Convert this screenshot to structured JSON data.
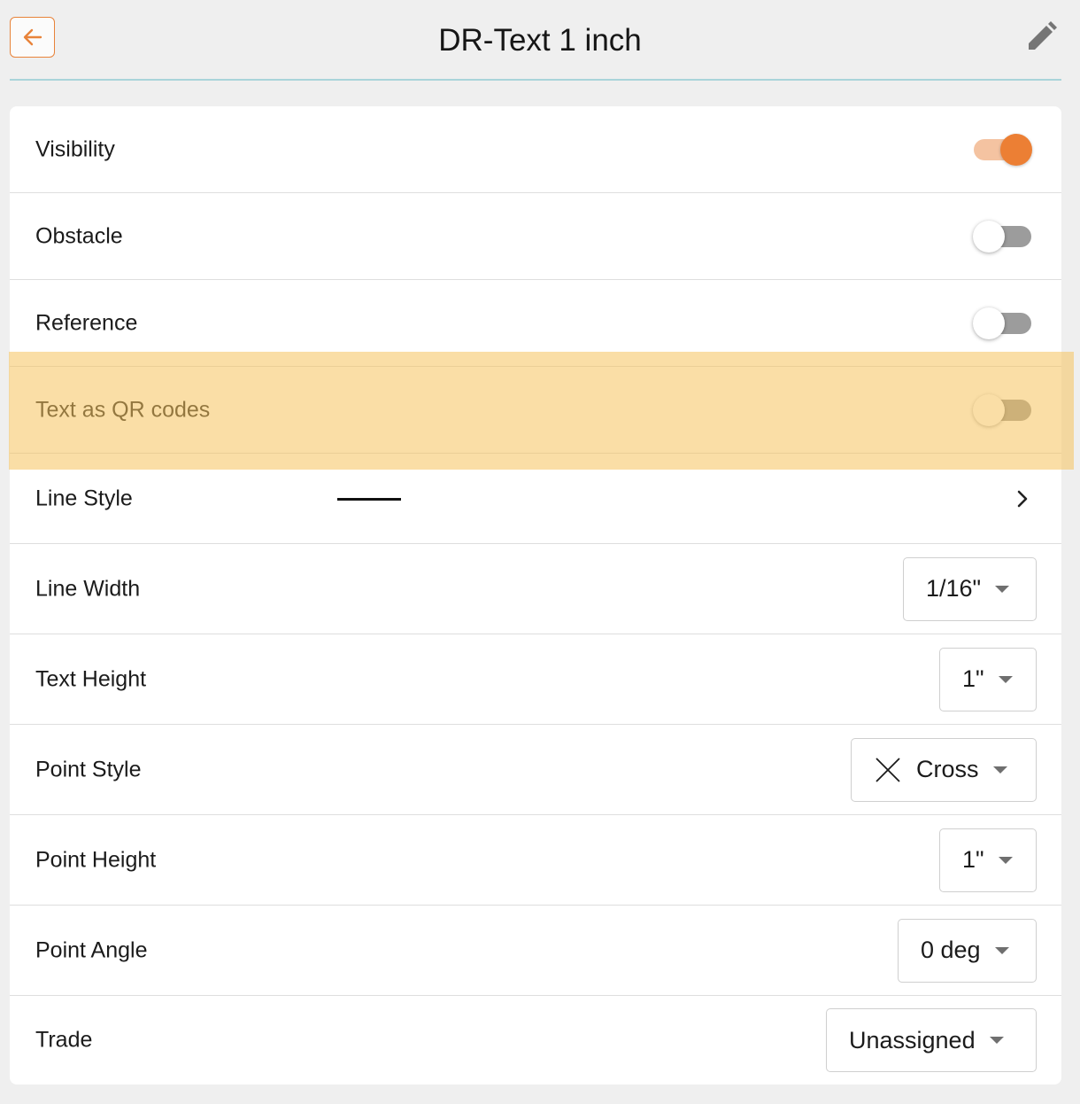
{
  "header": {
    "title": "DR-Text 1 inch",
    "icons": {
      "back": "arrow-left-icon",
      "edit": "pencil-icon"
    },
    "accent_color": "#e8833a"
  },
  "settings": {
    "visibility": {
      "label": "Visibility",
      "state": "on"
    },
    "obstacle": {
      "label": "Obstacle",
      "state": "off"
    },
    "reference": {
      "label": "Reference",
      "state": "off"
    },
    "qr_codes": {
      "label": "Text as QR codes",
      "state": "off",
      "highlighted": true
    },
    "line_style": {
      "label": "Line Style",
      "value": "solid"
    },
    "line_width": {
      "label": "Line Width",
      "value": "1/16\""
    },
    "text_height": {
      "label": "Text Height",
      "value": "1\""
    },
    "point_style": {
      "label": "Point Style",
      "value": "Cross",
      "icon": "cross-icon"
    },
    "point_height": {
      "label": "Point Height",
      "value": "1\""
    },
    "point_angle": {
      "label": "Point Angle",
      "value": "0 deg"
    },
    "trade": {
      "label": "Trade",
      "value": "Unassigned"
    }
  },
  "colors": {
    "toggle_on_knob": "#ec7f34",
    "toggle_on_track": "#f4c3a1",
    "toggle_off_track": "#9c9c9c",
    "highlight": "#f5c25c"
  }
}
